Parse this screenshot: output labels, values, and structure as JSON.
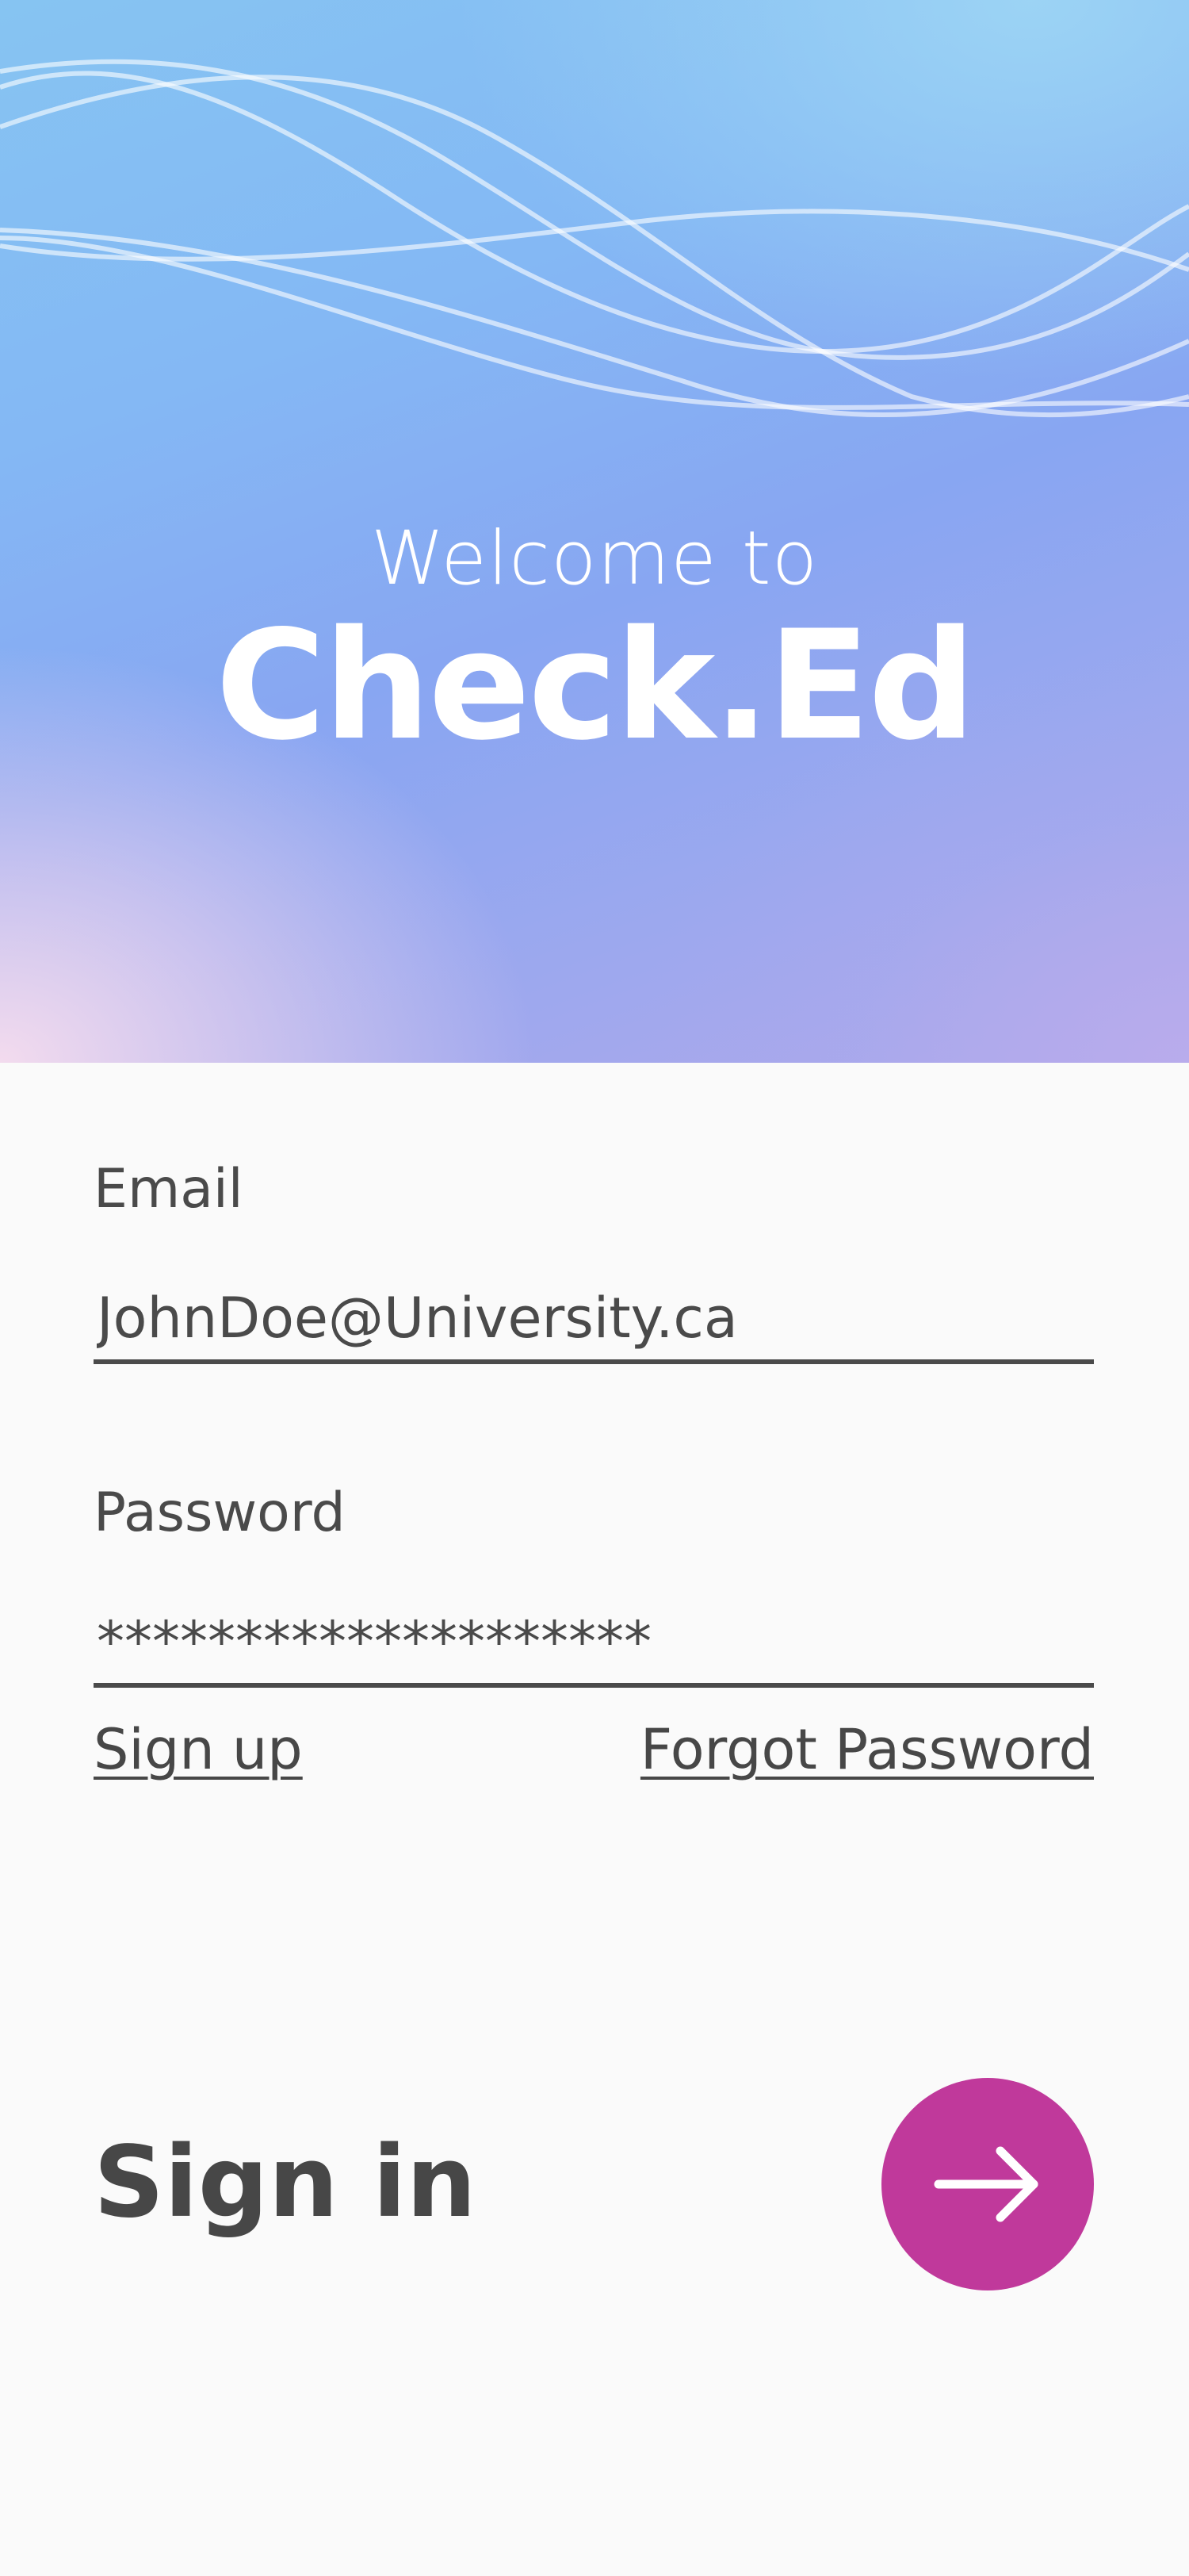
{
  "hero": {
    "welcome_text": "Welcome to",
    "app_name": "Check.Ed"
  },
  "form": {
    "email_label": "Email",
    "email_value": "JohnDoe@University.ca",
    "password_label": "Password",
    "password_value": "********************",
    "sign_up_link": "Sign up",
    "forgot_password_link": "Forgot Password",
    "sign_in_label": "Sign in",
    "submit_icon": "arrow-right-icon"
  },
  "colors": {
    "accent": "#c0399b",
    "text": "#4a4a4a",
    "background": "#fafafa"
  }
}
